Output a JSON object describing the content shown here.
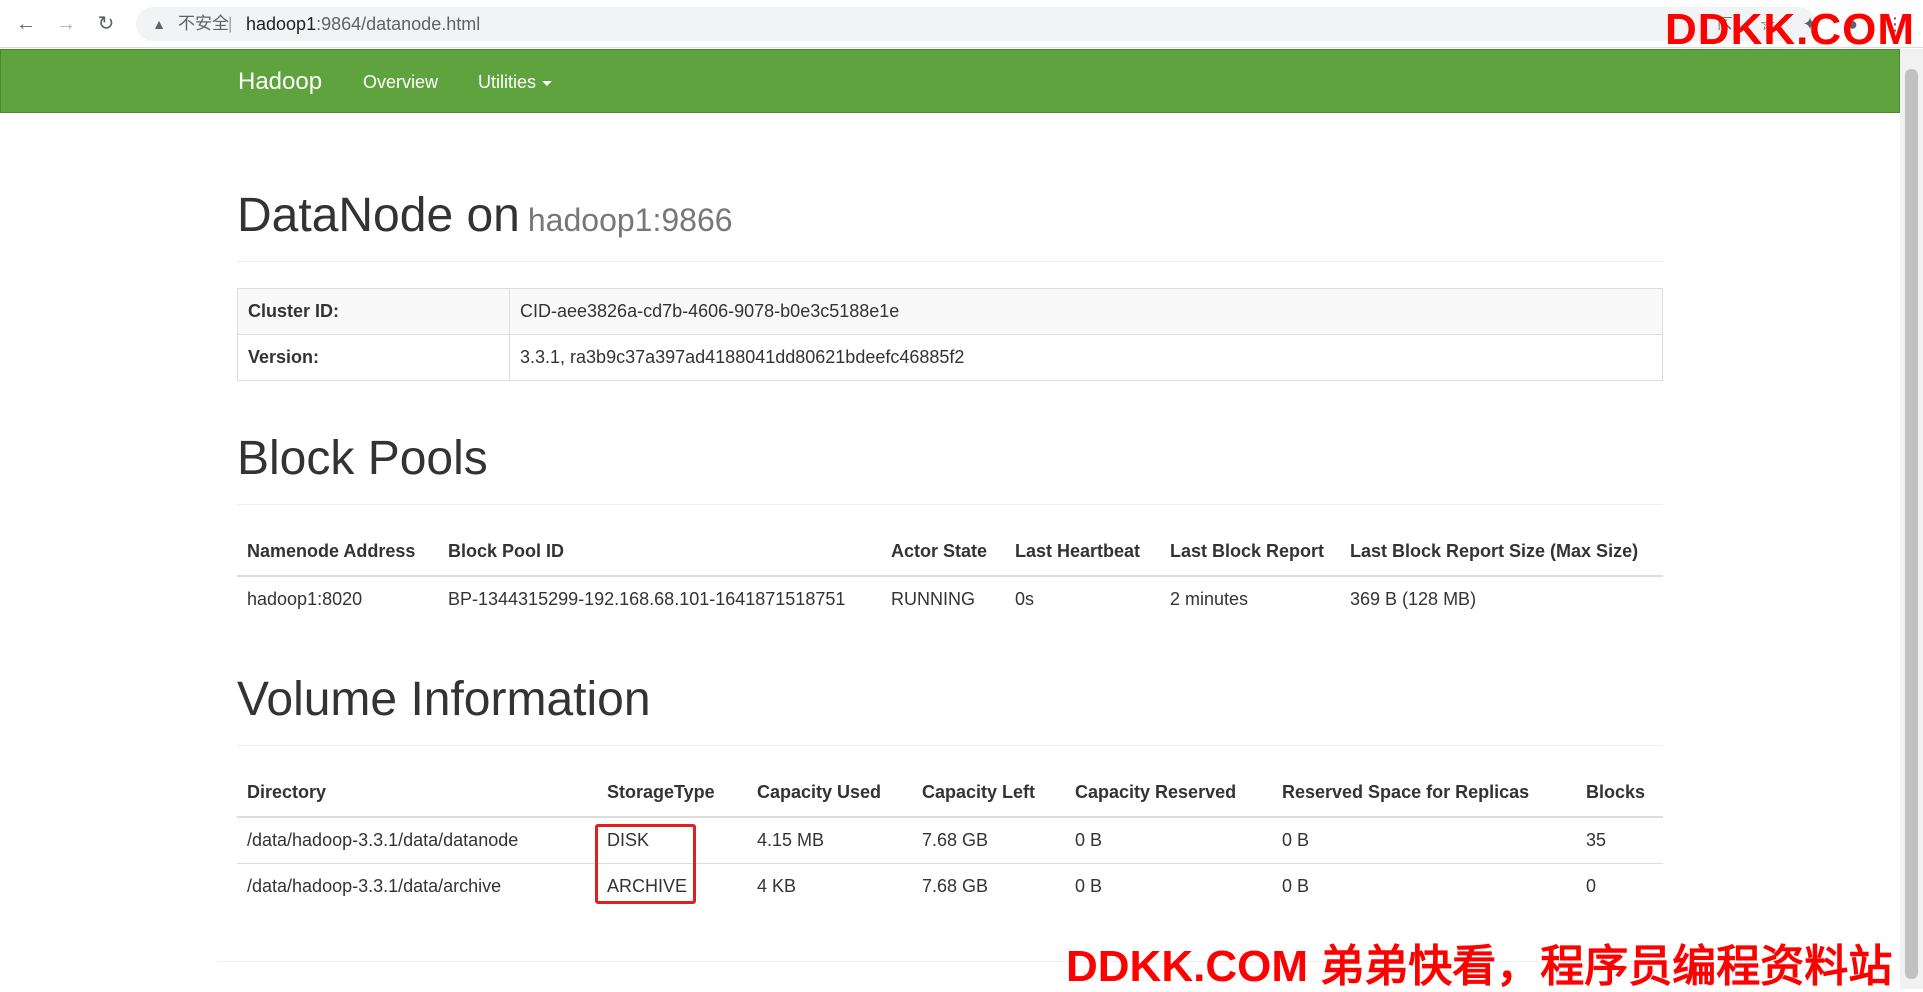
{
  "browser": {
    "insecure_label": "不安全",
    "separator": "|",
    "url_host": "hadoop1",
    "url_path": ":9864/datanode.html"
  },
  "watermark": {
    "top": "DDKK.COM",
    "bottom": "DDKK.COM 弟弟快看，程序员编程资料站"
  },
  "navbar": {
    "brand": "Hadoop",
    "links": [
      "Overview",
      "Utilities"
    ],
    "color": "#5fa33e"
  },
  "page": {
    "title": "DataNode on",
    "subtitle": "hadoop1:9866"
  },
  "info": [
    {
      "key": "Cluster ID:",
      "value": "CID-aee3826a-cd7b-4606-9078-b0e3c5188e1e"
    },
    {
      "key": "Version:",
      "value": "3.3.1, ra3b9c37a397ad4188041dd80621bdeefc46885f2"
    }
  ],
  "block_pools": {
    "heading": "Block Pools",
    "columns": [
      "Namenode Address",
      "Block Pool ID",
      "Actor State",
      "Last Heartbeat",
      "Last Block Report",
      "Last Block Report Size (Max Size)"
    ],
    "rows": [
      [
        "hadoop1:8020",
        "BP-1344315299-192.168.68.101-1641871518751",
        "RUNNING",
        "0s",
        "2 minutes",
        "369 B (128 MB)"
      ]
    ]
  },
  "volumes": {
    "heading": "Volume Information",
    "columns": [
      "Directory",
      "StorageType",
      "Capacity Used",
      "Capacity Left",
      "Capacity Reserved",
      "Reserved Space for Replicas",
      "Blocks"
    ],
    "rows": [
      [
        "/data/hadoop-3.3.1/data/datanode",
        "DISK",
        "4.15 MB",
        "7.68 GB",
        "0 B",
        "0 B",
        "35"
      ],
      [
        "/data/hadoop-3.3.1/data/archive",
        "ARCHIVE",
        "4 KB",
        "7.68 GB",
        "0 B",
        "0 B",
        "0"
      ]
    ]
  }
}
